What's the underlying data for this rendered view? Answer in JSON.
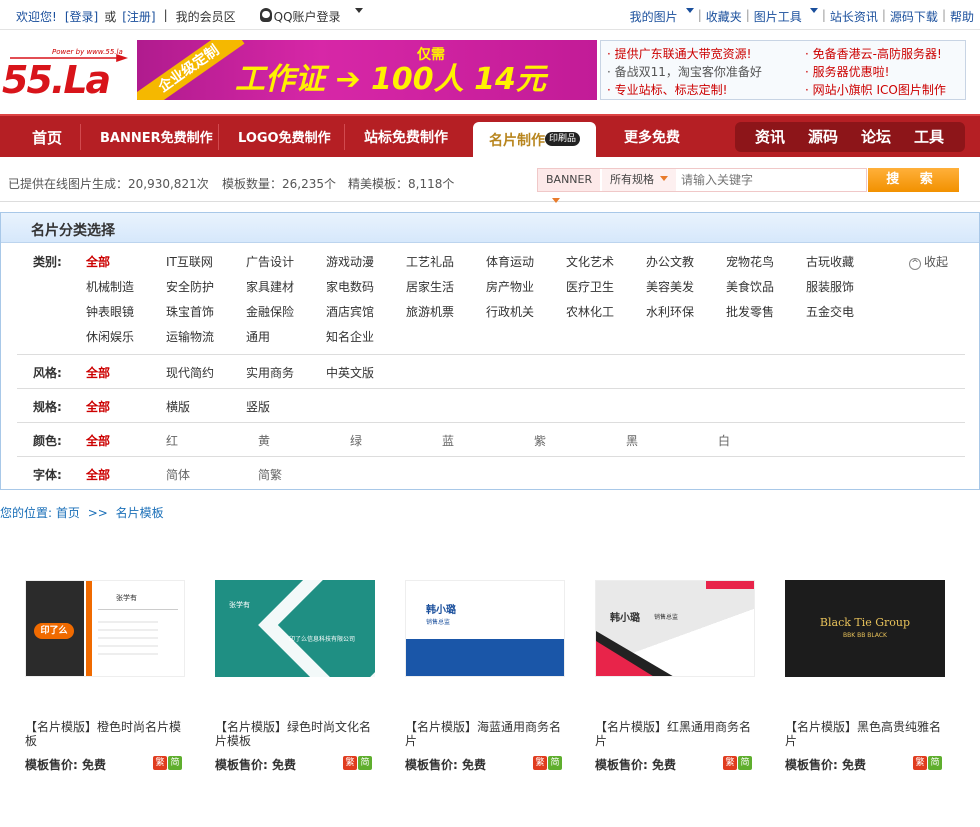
{
  "topbar": {
    "welcome": "欢迎您!",
    "login": "[登录]",
    "or": "或",
    "register": "[注册]",
    "sep": "|",
    "member": "我的会员区",
    "qq_login": "QQ账户登录",
    "right_links": [
      "我的图片",
      "收藏夹",
      "图片工具",
      "站长资讯",
      "源码下载",
      "帮助"
    ]
  },
  "header": {
    "logo_powered": "Power by www.55.la",
    "logo_text": "55.La",
    "banner_ribbon": "企业级定制",
    "banner_main": "工作证 ➔ 100人 14元",
    "banner_only": "仅需",
    "news_col1": [
      "提供广东联通大带宽资源!",
      "备战双11，淘宝客你准备好",
      "专业站标、标志定制!"
    ],
    "news_col2": [
      "免备香港云-高防服务器!",
      "服务器优惠啦!",
      "网站小旗帜 ICO图片制作"
    ]
  },
  "nav": {
    "items": [
      "首页",
      "BANNER免费制作",
      "LOGO免费制作",
      "站标免费制作",
      "名片制作",
      "更多免费"
    ],
    "active_tag": "印刷品",
    "right_items": [
      "资讯",
      "源码",
      "论坛",
      "工具"
    ]
  },
  "stats": {
    "generated": "已提供在线图片生成：20,930,821次",
    "templates": "模板数量：26,235个",
    "fine": "精美模板：8,118个"
  },
  "search": {
    "type_select": "BANNER",
    "spec_select": "所有规格",
    "placeholder": "请输入关键字",
    "button": "搜 索"
  },
  "category_panel": {
    "title": "名片分类选择",
    "collapse": "收起",
    "collapse_icon": "chevron-up-icon",
    "type_label": "类别:",
    "types": [
      "全部",
      "IT互联网",
      "广告设计",
      "游戏动漫",
      "工艺礼品",
      "体育运动",
      "文化艺术",
      "办公文教",
      "宠物花鸟",
      "古玩收藏",
      "机械制造",
      "安全防护",
      "家具建材",
      "家电数码",
      "居家生活",
      "房产物业",
      "医疗卫生",
      "美容美发",
      "美食饮品",
      "服装服饰",
      "钟表眼镜",
      "珠宝首饰",
      "金融保险",
      "酒店宾馆",
      "旅游机票",
      "行政机关",
      "农林化工",
      "水利环保",
      "批发零售",
      "五金交电",
      "休闲娱乐",
      "运输物流",
      "通用",
      "知名企业"
    ],
    "style_label": "风格:",
    "styles": [
      "全部",
      "现代简约",
      "实用商务",
      "中英文版"
    ],
    "spec_label": "规格:",
    "specs": [
      "全部",
      "横版",
      "竖版"
    ],
    "color_label": "颜色:",
    "colors": [
      "全部",
      "红",
      "黄",
      "绿",
      "蓝",
      "紫",
      "黑",
      "白"
    ],
    "font_label": "字体:",
    "fonts": [
      "全部",
      "简体",
      "简繁"
    ]
  },
  "breadcrumb": {
    "prefix": "您的位置:",
    "home": "首页",
    "arrow": ">>",
    "current": "名片模板"
  },
  "cards": [
    {
      "title": "【名片模版】橙色时尚名片模板",
      "price_label": "模板售价:",
      "price": "免费",
      "badge1": "繁",
      "badge2": "简",
      "thumb_name": "张学有",
      "thumb_role": "印了么",
      "thumb_logo": "印了么"
    },
    {
      "title": "【名片模版】绿色时尚文化名片模板",
      "price_label": "模板售价:",
      "price": "免费",
      "badge1": "繁",
      "badge2": "简",
      "thumb_name": "张学有",
      "thumb_role": "印了么信息科技有限公司"
    },
    {
      "title": "【名片模版】海蓝通用商务名片",
      "price_label": "模板售价:",
      "price": "免费",
      "badge1": "繁",
      "badge2": "简",
      "thumb_name": "韩小璐",
      "thumb_role": "销售总监"
    },
    {
      "title": "【名片模版】红黑通用商务名片",
      "price_label": "模板售价:",
      "price": "免费",
      "badge1": "繁",
      "badge2": "简",
      "thumb_name": "韩小璐",
      "thumb_role": "销售总监"
    },
    {
      "title": "【名片模版】黑色高贵纯雅名片",
      "price_label": "模板售价:",
      "price": "免费",
      "badge1": "繁",
      "badge2": "简",
      "thumb_name": "Black Tie Group",
      "thumb_role": "BBK BB BLACK"
    }
  ],
  "colors": {
    "nav_red": "#b51f24",
    "accent_orange": "#f29100",
    "selected_red": "#cc0000",
    "link_blue": "#1a4f9c"
  }
}
